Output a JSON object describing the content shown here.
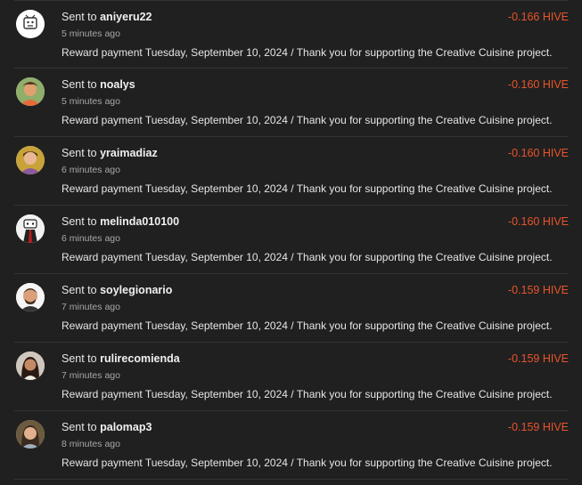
{
  "transactions": [
    {
      "sent_prefix": "Sent to",
      "user": "aniyeru22",
      "time": "5 minutes ago",
      "amount": "-0.166 HIVE",
      "memo": "Reward payment Tuesday, September 10, 2024 / Thank you for supporting the Creative Cuisine project.",
      "avatar_colors": [
        "#ffffff",
        "#333333"
      ]
    },
    {
      "sent_prefix": "Sent to",
      "user": "noalys",
      "time": "5 minutes ago",
      "amount": "-0.160 HIVE",
      "memo": "Reward payment Tuesday, September 10, 2024 / Thank you for supporting the Creative Cuisine project.",
      "avatar_colors": [
        "#d98b4f",
        "#2e7d32"
      ]
    },
    {
      "sent_prefix": "Sent to",
      "user": "yraimadiaz",
      "time": "6 minutes ago",
      "amount": "-0.160 HIVE",
      "memo": "Reward payment Tuesday, September 10, 2024 / Thank you for supporting the Creative Cuisine project.",
      "avatar_colors": [
        "#c9a23a",
        "#8a5a9e"
      ]
    },
    {
      "sent_prefix": "Sent to",
      "user": "melinda010100",
      "time": "6 minutes ago",
      "amount": "-0.160 HIVE",
      "memo": "Reward payment Tuesday, September 10, 2024 / Thank you for supporting the Creative Cuisine project.",
      "avatar_colors": [
        "#f2f2f2",
        "#b71c1c"
      ]
    },
    {
      "sent_prefix": "Sent to",
      "user": "soylegionario",
      "time": "7 minutes ago",
      "amount": "-0.159 HIVE",
      "memo": "Reward payment Tuesday, September 10, 2024 / Thank you for supporting the Creative Cuisine project.",
      "avatar_colors": [
        "#f5f5f5",
        "#3e2a20"
      ]
    },
    {
      "sent_prefix": "Sent to",
      "user": "rulirecomienda",
      "time": "7 minutes ago",
      "amount": "-0.159 HIVE",
      "memo": "Reward payment Tuesday, September 10, 2024 / Thank you for supporting the Creative Cuisine project.",
      "avatar_colors": [
        "#cfc6bd",
        "#2b1a14"
      ]
    },
    {
      "sent_prefix": "Sent to",
      "user": "palomap3",
      "time": "8 minutes ago",
      "amount": "-0.159 HIVE",
      "memo": "Reward payment Tuesday, September 10, 2024 / Thank you for supporting the Creative Cuisine project.",
      "avatar_colors": [
        "#6b5a3e",
        "#3b2a20"
      ]
    }
  ],
  "colors": {
    "amount": "#e8542b",
    "background": "#202020"
  }
}
